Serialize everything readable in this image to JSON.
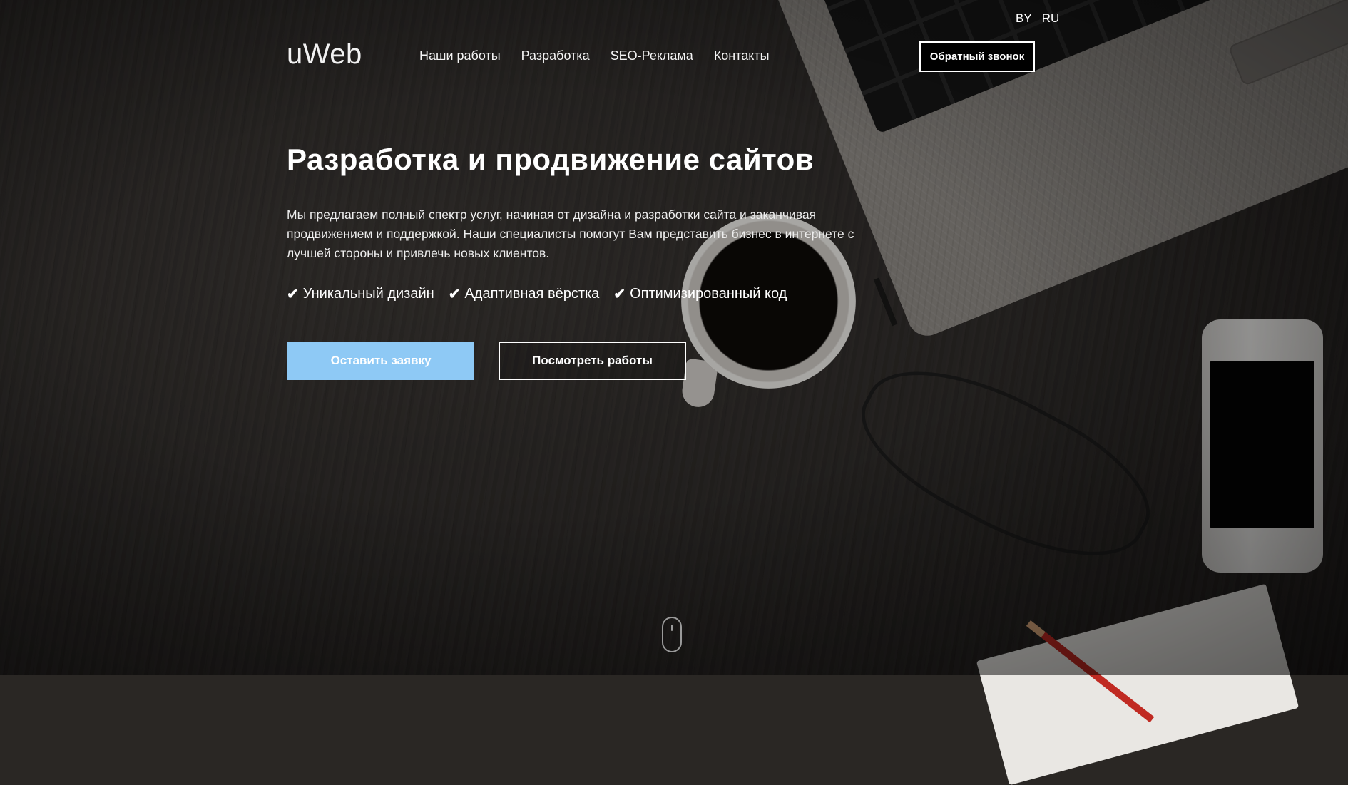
{
  "header": {
    "logo": "uWeb",
    "languages": [
      "BY",
      "RU"
    ],
    "nav": [
      "Наши работы",
      "Разработка",
      "SEO-Реклама",
      "Контакты"
    ],
    "callback_label": "Обратный звонок"
  },
  "hero": {
    "title": "Разработка и продвижение сайтов",
    "description": "Мы предлагаем полный спектр услуг, начиная от дизайна и разработки сайта и заканчивая продвижением и поддержкой. Наши специалисты помогут Вам представить бизнес в интернете с лучшей стороны и привлечь новых клиентов.",
    "features": [
      "Уникальный дизайн",
      "Адаптивная вёрстка",
      "Оптимизированный код"
    ],
    "primary_button": "Оставить заявку",
    "secondary_button": "Посмотреть работы"
  },
  "colors": {
    "accent": "#8ec9f5",
    "callback_bg": "#000000",
    "text": "#ffffff"
  },
  "icons": {
    "feature_check": "check-icon",
    "scroll": "mouse-scroll-icon"
  }
}
